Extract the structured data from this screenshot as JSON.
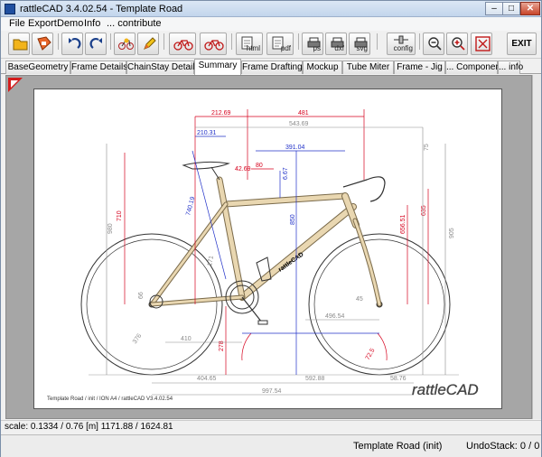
{
  "window": {
    "title": "rattleCAD  3.4.02.54 - Template Road"
  },
  "window_controls": {
    "minimize": "–",
    "maximize": "□",
    "close": "✕"
  },
  "menu": [
    "File",
    "Export",
    "Demo",
    "Info",
    "... contribute"
  ],
  "toolbar": {
    "html_label": "html",
    "pdf_label": "pdf",
    "ps_label": "ps",
    "dxf_label": "dxf",
    "svg_label": "svg",
    "config_label": "config",
    "exit_label": "EXIT"
  },
  "tabs": [
    "BaseGeometry",
    "Frame Details",
    "ChainStay Details",
    "Summary",
    "Frame Drafting",
    "Mockup",
    "Tube Miter",
    "Frame - Jig",
    "... Components",
    "... info"
  ],
  "active_tab": "Summary",
  "drawing": {
    "dims_red": [
      "212.69",
      "481",
      "42.69",
      "80",
      "710",
      "656.51",
      "635",
      "278",
      "72.5"
    ],
    "dims_blue": [
      "210.31",
      "391.04",
      "740.19",
      "850",
      "6.67"
    ],
    "dims_gray": [
      "543.69",
      "75",
      "980",
      "905",
      "66",
      "376",
      "410",
      "496.54",
      "404.65",
      "592.88",
      "58.76",
      "997.54",
      "171",
      "45"
    ],
    "logo_text": "rattleCAD",
    "footer_text": "Template Road  /  init  / ION A4 /  rattleCAD  V3.4.02.54",
    "colors": {
      "frame": "#e9d7b1",
      "frame_line": "#7a6a4a",
      "red": "#d6001c",
      "blue": "#2030c8",
      "gray": "#8a8a8a"
    }
  },
  "scale": {
    "text": "scale: 0.1334 / 0.76  [m]  1171.88 / 1624.81"
  },
  "status": {
    "project": "Template Road (init)",
    "undo": "UndoStack:  0 / 0"
  }
}
